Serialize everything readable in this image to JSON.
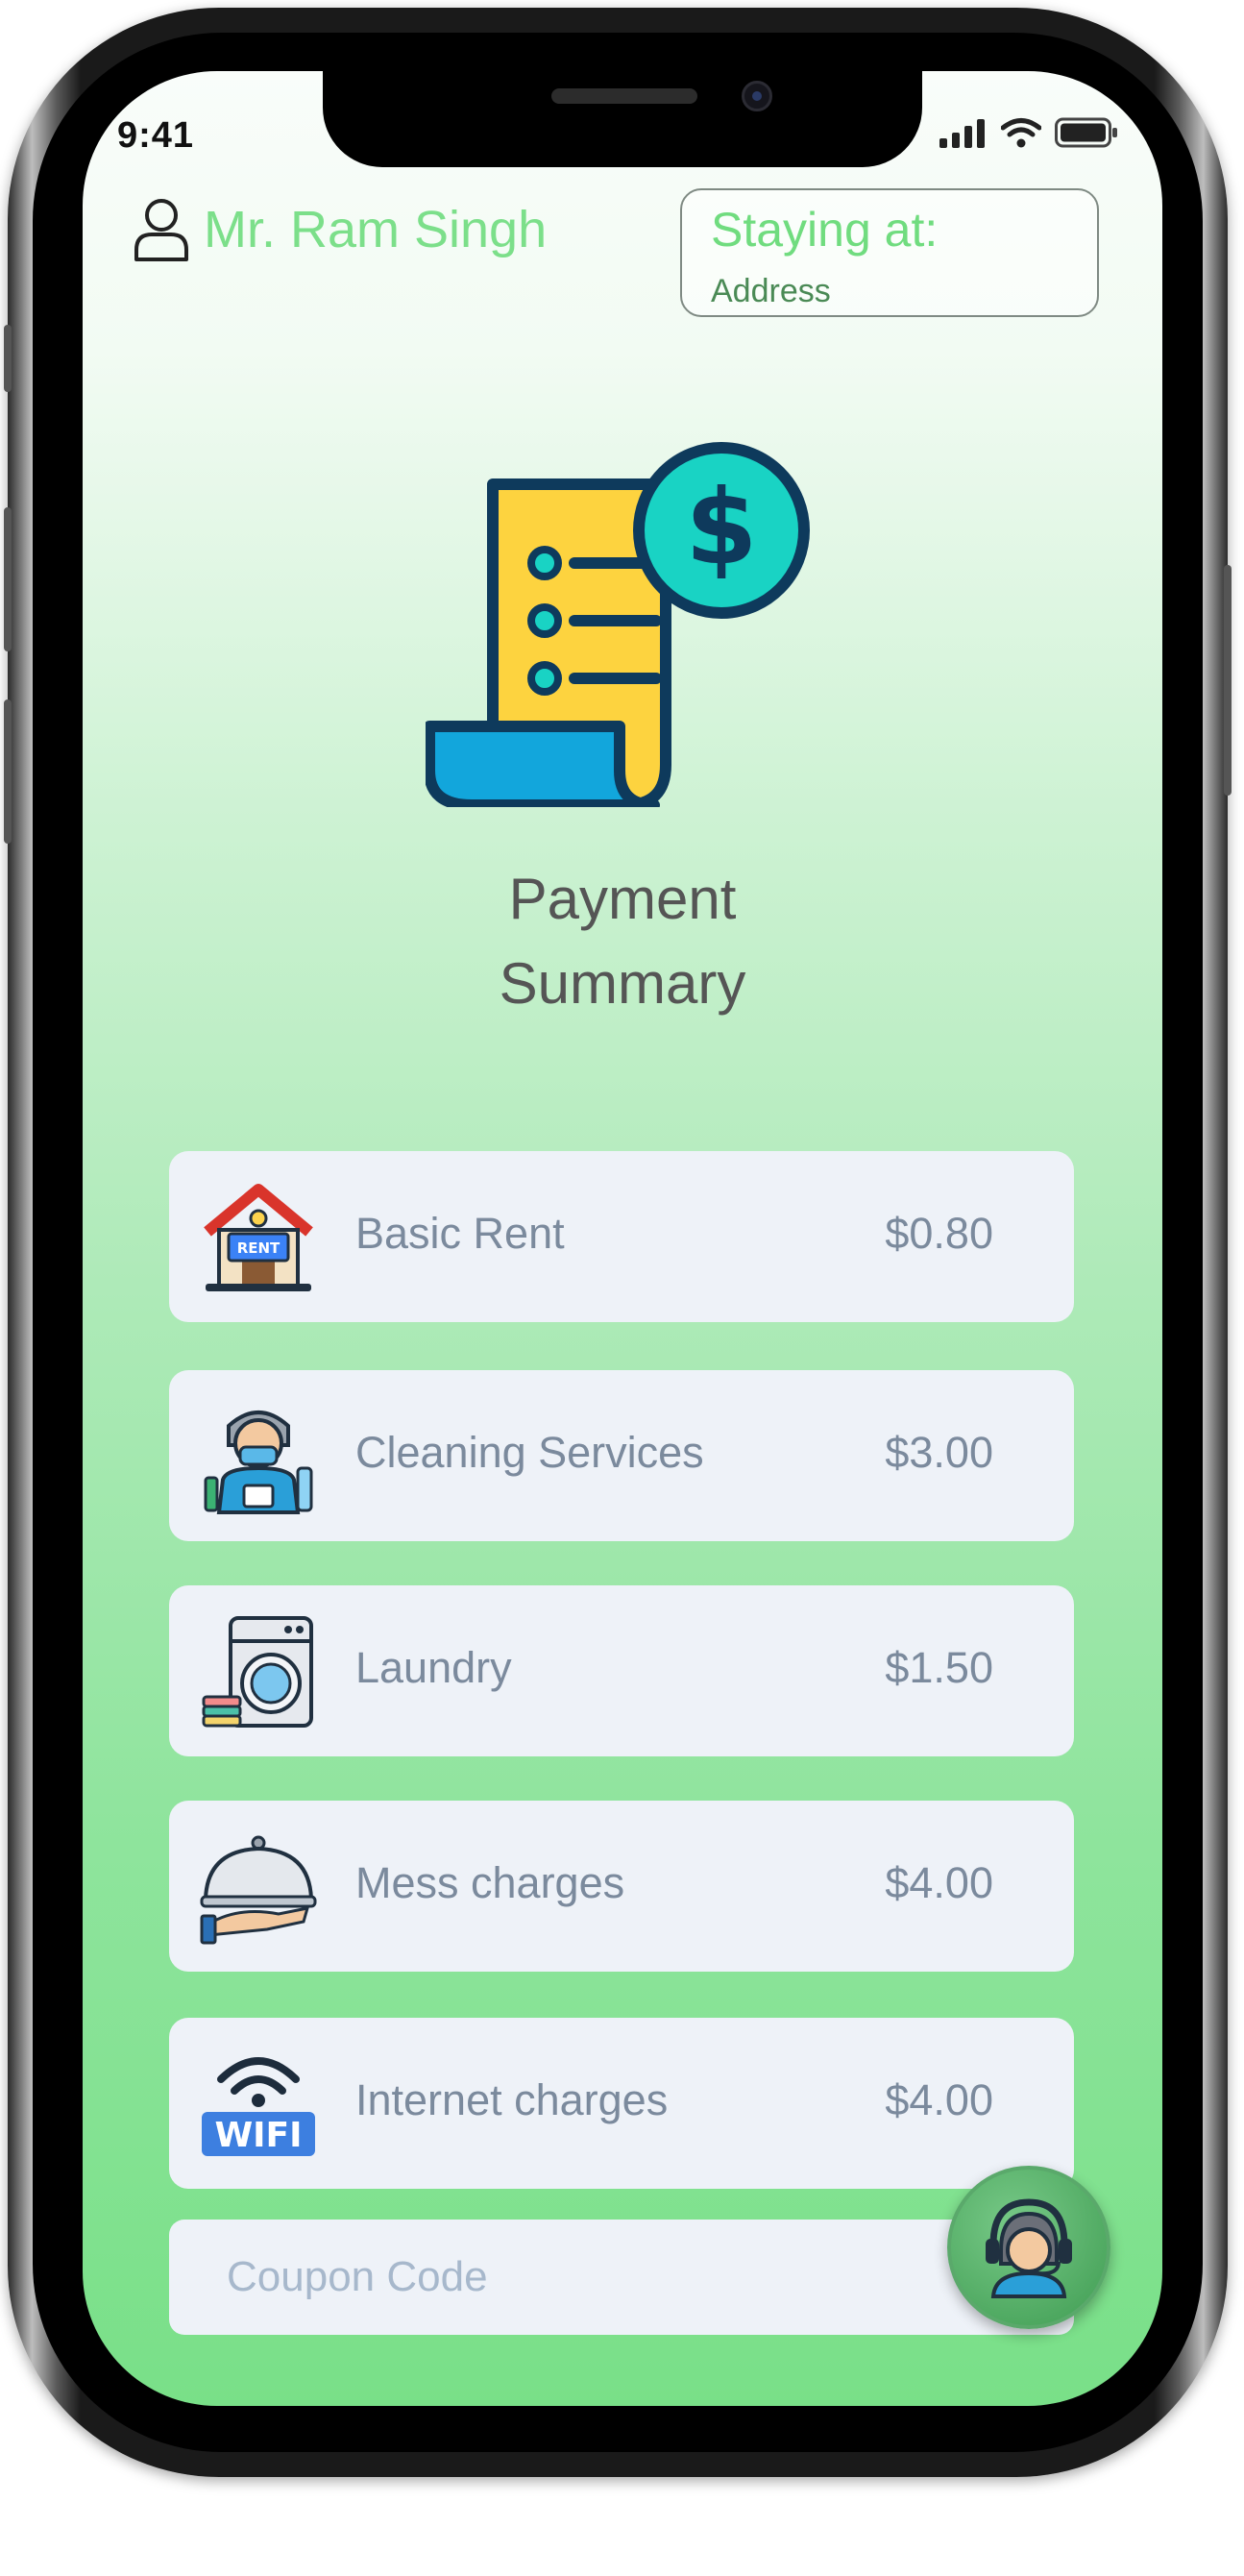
{
  "status_bar": {
    "time": "9:41"
  },
  "header": {
    "user_name": "Mr. Ram Singh",
    "staying_label": "Staying at:",
    "staying_value": "Address"
  },
  "page": {
    "title_line1": "Payment",
    "title_line2": "Summary"
  },
  "charges": [
    {
      "icon": "rent-house-icon",
      "label": "Basic Rent",
      "amount": "$0.80"
    },
    {
      "icon": "cleaning-staff-icon",
      "label": "Cleaning Services",
      "amount": "$3.00"
    },
    {
      "icon": "washing-machine-icon",
      "label": "Laundry",
      "amount": "$1.50"
    },
    {
      "icon": "food-cloche-icon",
      "label": "Mess charges",
      "amount": "$4.00"
    },
    {
      "icon": "wifi-icon",
      "label": "Internet charges",
      "amount": "$4.00"
    }
  ],
  "coupon": {
    "placeholder": "Coupon Code",
    "value": ""
  },
  "support": {
    "icon": "customer-support-icon"
  },
  "colors": {
    "accent_green": "#7cdf8a",
    "card_bg": "#eef2f8",
    "text_gray": "#7b8a9d"
  }
}
